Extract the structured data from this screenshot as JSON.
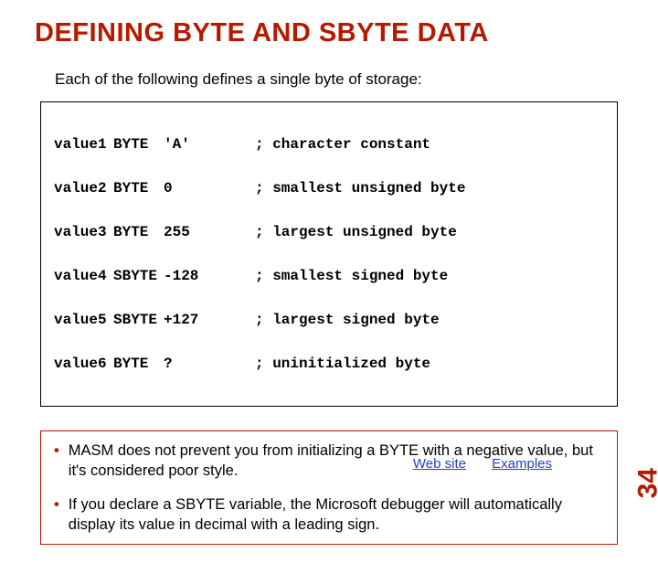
{
  "title": "DEFINING BYTE AND SBYTE DATA",
  "intro": "Each of the following defines a single byte of storage:",
  "code": [
    {
      "name": "value1",
      "type": "BYTE",
      "val": "'A'",
      "comment": "; character constant"
    },
    {
      "name": "value2",
      "type": "BYTE",
      "val": "0",
      "comment": "; smallest unsigned byte"
    },
    {
      "name": "value3",
      "type": "BYTE",
      "val": "255",
      "comment": "; largest unsigned byte"
    },
    {
      "name": "value4",
      "type": "SBYTE",
      "val": "-128",
      "comment": "; smallest signed byte"
    },
    {
      "name": "value5",
      "type": "SBYTE",
      "val": "+127",
      "comment": "; largest signed byte"
    },
    {
      "name": "value6",
      "type": "BYTE",
      "val": "?",
      "comment": "; uninitialized byte"
    }
  ],
  "notes": [
    "MASM does not prevent you from initializing a BYTE with a negative value, but it's considered poor style.",
    "If you declare a SBYTE variable, the Microsoft debugger will automatically display its value in decimal with a leading sign."
  ],
  "links": {
    "website": "Web site",
    "examples": "Examples"
  },
  "page": "34"
}
